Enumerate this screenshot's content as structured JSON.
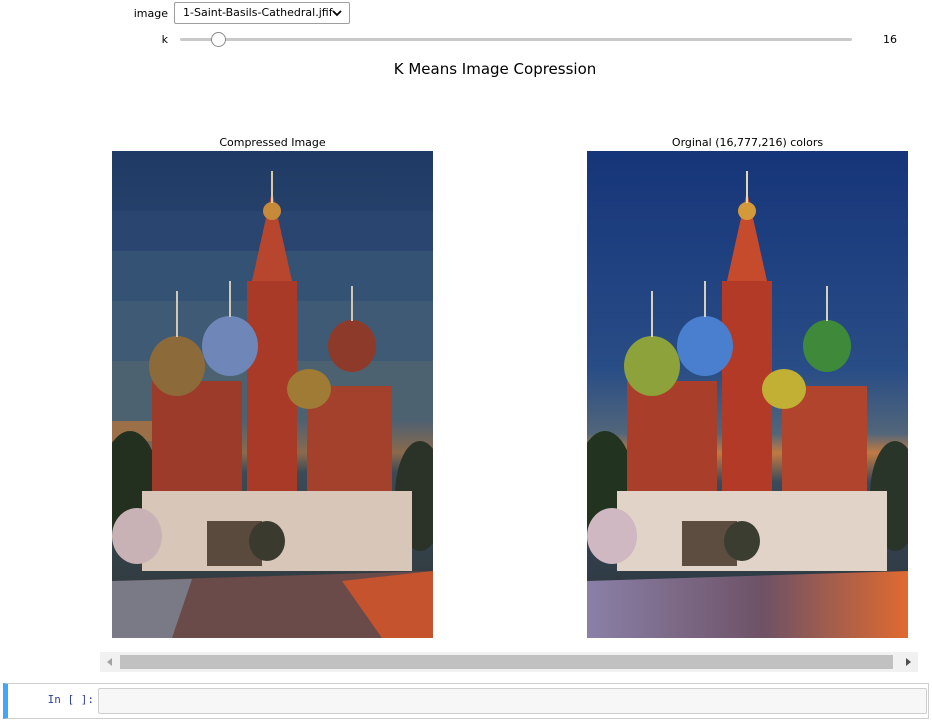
{
  "widgets": {
    "image_label": "image",
    "image_selected": "1-Saint-Basils-Cathedral.jfif",
    "k_label": "k",
    "k_value": "16",
    "k_slider": {
      "min": 2,
      "max": 256,
      "value": 16
    }
  },
  "figure": {
    "suptitle": "K Means Image Copression",
    "left_title": "Compressed Image",
    "right_title": "Orginal (16,777,216) colors"
  },
  "cell": {
    "prompt": "In [ ]:"
  },
  "colors": {
    "sky_compressed": "#1f3a64",
    "sky_original": "#16357a",
    "accent_cell": "#42a5f5",
    "brick": "#b23a27"
  },
  "icons": {
    "dropdown": "chevron-down-icon",
    "scroll_left": "arrow-left-icon",
    "scroll_right": "arrow-right-icon"
  }
}
